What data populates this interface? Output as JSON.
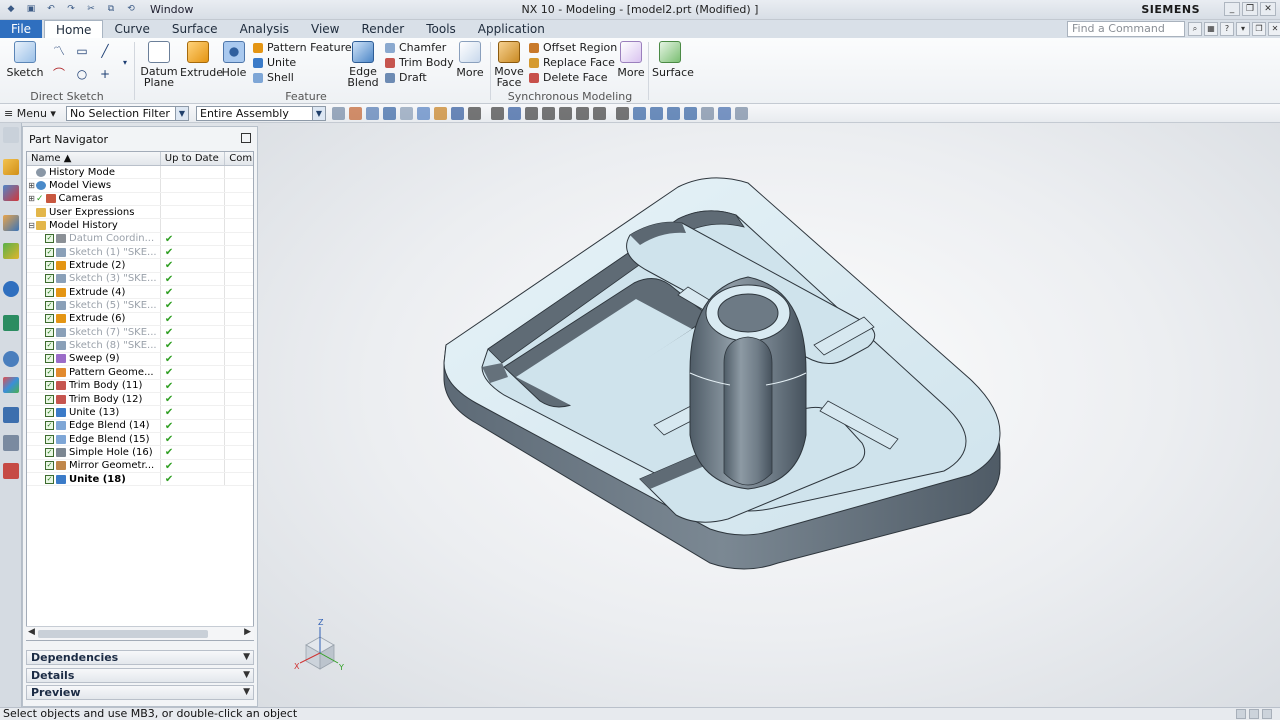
{
  "titlebar": {
    "window_menu": "Window",
    "title": "NX 10 - Modeling - [model2.prt (Modified) ]",
    "brand": "SIEMENS"
  },
  "menubar": {
    "file": "File",
    "tabs": [
      "Home",
      "Curve",
      "Surface",
      "Analysis",
      "View",
      "Render",
      "Tools",
      "Application"
    ],
    "active_tab": "Home",
    "find_placeholder": "Find a Command"
  },
  "ribbon": {
    "direct_sketch": {
      "label": "Direct Sketch",
      "sketch": "Sketch"
    },
    "feature": {
      "label": "Feature",
      "datum_plane": "Datum Plane",
      "extrude": "Extrude",
      "hole": "Hole",
      "pattern_feature": "Pattern Feature",
      "unite": "Unite",
      "shell": "Shell",
      "edge_blend": "Edge Blend",
      "chamfer": "Chamfer",
      "trim_body": "Trim Body",
      "draft": "Draft",
      "more": "More"
    },
    "synchronous": {
      "label": "Synchronous Modeling",
      "move_face": "Move Face",
      "offset_region": "Offset Region",
      "replace_face": "Replace Face",
      "delete_face": "Delete Face",
      "more": "More"
    },
    "surface": "Surface"
  },
  "selection_bar": {
    "menu": "Menu",
    "filter": "No Selection Filter",
    "scope": "Entire Assembly"
  },
  "part_navigator": {
    "title": "Part Navigator",
    "columns": [
      "Name",
      "Up to Date",
      "Com"
    ],
    "rows": [
      {
        "name": "History Mode",
        "kind": "clock",
        "style": "normal",
        "uptodate": false
      },
      {
        "name": "Model Views",
        "kind": "views",
        "style": "normal",
        "uptodate": false
      },
      {
        "name": "Cameras",
        "kind": "camera",
        "style": "normal",
        "uptodate": false
      },
      {
        "name": "User Expressions",
        "kind": "folder",
        "style": "normal",
        "uptodate": false
      },
      {
        "name": "Model History",
        "kind": "folder",
        "style": "normal",
        "uptodate": false
      },
      {
        "name": "Datum Coordin...",
        "kind": "datum",
        "style": "gray",
        "uptodate": true
      },
      {
        "name": "Sketch (1) \"SKE...",
        "kind": "sketch",
        "style": "gray",
        "uptodate": true
      },
      {
        "name": "Extrude (2)",
        "kind": "extrude",
        "style": "normal",
        "uptodate": true
      },
      {
        "name": "Sketch (3) \"SKE...",
        "kind": "sketch",
        "style": "gray",
        "uptodate": true
      },
      {
        "name": "Extrude (4)",
        "kind": "extrude",
        "style": "normal",
        "uptodate": true
      },
      {
        "name": "Sketch (5) \"SKE...",
        "kind": "sketch",
        "style": "gray",
        "uptodate": true
      },
      {
        "name": "Extrude (6)",
        "kind": "extrude",
        "style": "normal",
        "uptodate": true
      },
      {
        "name": "Sketch (7) \"SKE...",
        "kind": "sketch",
        "style": "gray",
        "uptodate": true
      },
      {
        "name": "Sketch (8) \"SKE...",
        "kind": "sketch",
        "style": "gray",
        "uptodate": true
      },
      {
        "name": "Sweep (9)",
        "kind": "sweep",
        "style": "normal",
        "uptodate": true
      },
      {
        "name": "Pattern Geome...",
        "kind": "pattern",
        "style": "normal",
        "uptodate": true
      },
      {
        "name": "Trim Body (11)",
        "kind": "trim",
        "style": "normal",
        "uptodate": true
      },
      {
        "name": "Trim Body (12)",
        "kind": "trim",
        "style": "normal",
        "uptodate": true
      },
      {
        "name": "Unite (13)",
        "kind": "unite",
        "style": "normal",
        "uptodate": true
      },
      {
        "name": "Edge Blend (14)",
        "kind": "blend",
        "style": "normal",
        "uptodate": true
      },
      {
        "name": "Edge Blend (15)",
        "kind": "blend",
        "style": "normal",
        "uptodate": true
      },
      {
        "name": "Simple Hole (16)",
        "kind": "hole",
        "style": "normal",
        "uptodate": true
      },
      {
        "name": "Mirror Geometr...",
        "kind": "mirror",
        "style": "normal",
        "uptodate": true
      },
      {
        "name": "Unite (18)",
        "kind": "unite",
        "style": "bold",
        "uptodate": true
      }
    ],
    "panels": [
      "Dependencies",
      "Details",
      "Preview"
    ]
  },
  "triad": {
    "x": "X",
    "y": "Y",
    "z": "Z"
  },
  "status": "Select objects and use MB3, or double-click an object"
}
